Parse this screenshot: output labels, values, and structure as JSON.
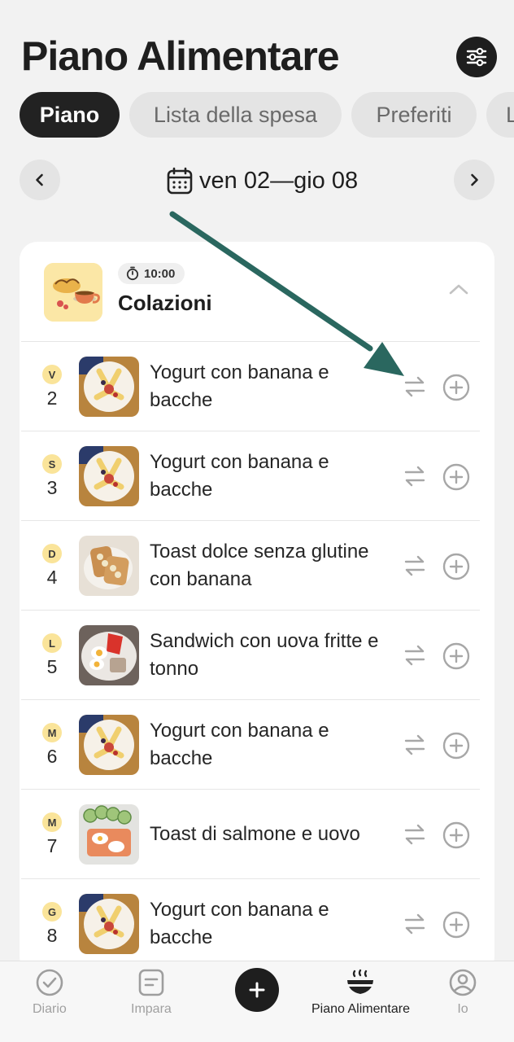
{
  "app": {
    "title": "Piano Alimentare"
  },
  "tabs": [
    {
      "label": "Piano",
      "active": true
    },
    {
      "label": "Lista della spesa",
      "active": false
    },
    {
      "label": "Preferiti",
      "active": false
    },
    {
      "label": "L",
      "active": false
    }
  ],
  "week": {
    "range": "ven 02—gio 08"
  },
  "meal": {
    "time": "10:00",
    "name": "Colazioni",
    "items": [
      {
        "day_letter": "V",
        "day_num": "2",
        "recipe": "Yogurt con banana e bacche"
      },
      {
        "day_letter": "S",
        "day_num": "3",
        "recipe": "Yogurt con banana e bacche"
      },
      {
        "day_letter": "D",
        "day_num": "4",
        "recipe": "Toast dolce senza glutine con banana"
      },
      {
        "day_letter": "L",
        "day_num": "5",
        "recipe": "Sandwich con uova fritte e tonno"
      },
      {
        "day_letter": "M",
        "day_num": "6",
        "recipe": "Yogurt con banana e bacche"
      },
      {
        "day_letter": "M",
        "day_num": "7",
        "recipe": "Toast di salmone e uovo"
      },
      {
        "day_letter": "G",
        "day_num": "8",
        "recipe": "Yogurt con banana e bacche"
      }
    ]
  },
  "bottom_nav": {
    "diario": "Diario",
    "impara": "Impara",
    "piano": "Piano Alimentare",
    "io": "Io"
  },
  "colors": {
    "background": "#f2f2f2",
    "dark": "#1e1e1e",
    "day_badge": "#fae49a",
    "annotation_arrow": "#2a675f"
  }
}
